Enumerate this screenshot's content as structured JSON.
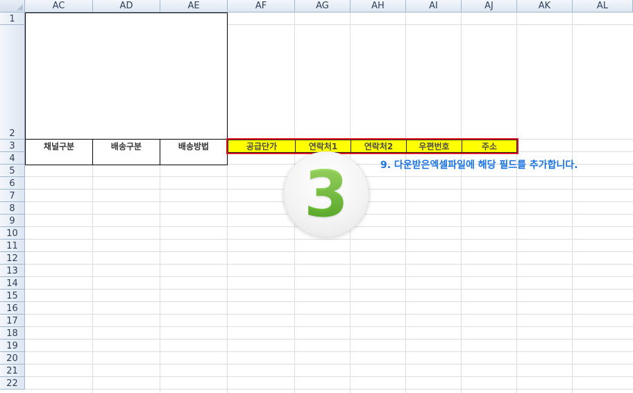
{
  "columns": [
    "AC",
    "AD",
    "AE",
    "AF",
    "AG",
    "AH",
    "AI",
    "AJ",
    "AK",
    "AL"
  ],
  "rows": [
    "1",
    "2",
    "3",
    "4",
    "5",
    "6",
    "7",
    "8",
    "9",
    "10",
    "11",
    "12",
    "13",
    "14",
    "15",
    "16",
    "17",
    "18",
    "19",
    "20",
    "21",
    "22"
  ],
  "header_cells": {
    "channel_type": "채널구분",
    "shipping_type": "배송구분",
    "shipping_method": "배송방법",
    "supply_price": "공급단가",
    "contact1": "연락처1",
    "contact2": "연락처2",
    "postal_code": "우편번호",
    "address": "주소"
  },
  "instruction_text": "9. 다운받은엑셀파일에 해당 필드를 추가합니다.",
  "step_number": "3",
  "colors": {
    "highlight_fill": "#ffff00",
    "highlight_border": "#e0141e",
    "instruction_text": "#1a73e0",
    "step_number": "#6fc23a"
  }
}
